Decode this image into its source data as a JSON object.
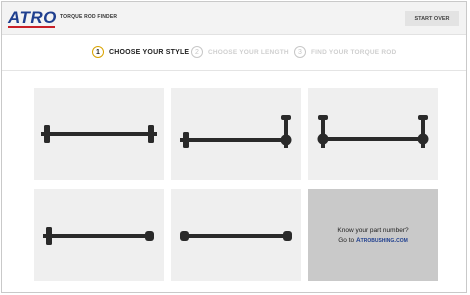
{
  "header": {
    "logo_text": "ATRO",
    "app_title_prefix": "TORQUE ROD",
    "app_title_bold": "FINDER",
    "start_over_label": "START OVER",
    "colors": {
      "logo_blue": "#1f3f8f",
      "logo_red": "#c82027",
      "step_accent": "#d9a300"
    }
  },
  "steps": [
    {
      "number": "1",
      "label": "CHOOSE YOUR STYLE",
      "active": true
    },
    {
      "number": "2",
      "label": "CHOOSE YOUR LENGTH",
      "active": false
    },
    {
      "number": "3",
      "label": "FIND YOUR TORQUE ROD",
      "active": false
    }
  ],
  "styles": [
    {
      "name": "straight-rod-both-ends-upright-bushing"
    },
    {
      "name": "rod-left-bushing-right-vertical-pin"
    },
    {
      "name": "rod-both-ends-vertical-pins"
    },
    {
      "name": "straight-rod-left-bushing-right-round"
    },
    {
      "name": "straight-rod-rounded-ends"
    }
  ],
  "info_tile": {
    "line1": "Know your part number?",
    "line2_prefix": "Go to",
    "link_text": "Atrobushing.com"
  }
}
